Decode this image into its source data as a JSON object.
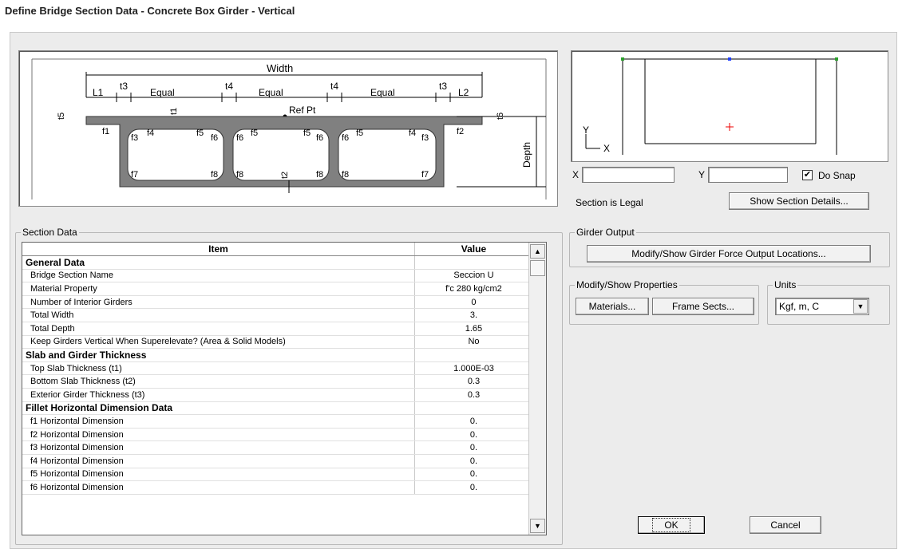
{
  "window": {
    "title": "Define Bridge Section Data - Concrete Box Girder - Vertical"
  },
  "diagram": {
    "width": "Width",
    "L1": "L1",
    "L2": "L2",
    "t3": "t3",
    "t4": "t4",
    "equal": "Equal",
    "ref_pt": "Ref Pt",
    "t1": "t1",
    "t2": "t2",
    "t5": "t5",
    "t6": "t6",
    "depth": "Depth",
    "f1": "f1",
    "f2": "f2",
    "f3": "f3",
    "f4": "f4",
    "f5": "f5",
    "f6": "f6",
    "f7": "f7",
    "f8": "f8"
  },
  "preview": {
    "x_label": "X",
    "y_label": "Y",
    "do_snap_label": "Do Snap",
    "do_snap_checked": true,
    "status": "Section is Legal",
    "show_details_button": "Show Section Details..."
  },
  "section_data": {
    "caption": "Section Data",
    "headers": [
      "Item",
      "Value"
    ],
    "rows": [
      {
        "kind": "hdr",
        "item": "General Data",
        "value": ""
      },
      {
        "kind": "row",
        "item": "Bridge Section Name",
        "value": "Seccion U"
      },
      {
        "kind": "row",
        "item": "Material Property",
        "value": "f'c 280 kg/cm2"
      },
      {
        "kind": "row",
        "item": "Number of Interior Girders",
        "value": "0"
      },
      {
        "kind": "row",
        "item": "Total Width",
        "value": "3."
      },
      {
        "kind": "row",
        "item": "Total Depth",
        "value": "1.65"
      },
      {
        "kind": "row",
        "item": "Keep Girders Vertical When Superelevate?  (Area & Solid Models)",
        "value": "No"
      },
      {
        "kind": "hdr",
        "item": "Slab and Girder Thickness",
        "value": ""
      },
      {
        "kind": "row",
        "item": "Top Slab Thickness (t1)",
        "value": "1.000E-03"
      },
      {
        "kind": "row",
        "item": "Bottom Slab Thickness (t2)",
        "value": "0.3"
      },
      {
        "kind": "row",
        "item": "Exterior Girder Thickness (t3)",
        "value": "0.3"
      },
      {
        "kind": "hdr",
        "item": "Fillet Horizontal Dimension Data",
        "value": ""
      },
      {
        "kind": "row",
        "item": "f1 Horizontal Dimension",
        "value": "0."
      },
      {
        "kind": "row",
        "item": "f2 Horizontal Dimension",
        "value": "0."
      },
      {
        "kind": "row",
        "item": "f3 Horizontal Dimension",
        "value": "0."
      },
      {
        "kind": "row",
        "item": "f4 Horizontal Dimension",
        "value": "0."
      },
      {
        "kind": "row",
        "item": "f5 Horizontal Dimension",
        "value": "0."
      },
      {
        "kind": "row",
        "item": "f6 Horizontal Dimension",
        "value": "0."
      }
    ]
  },
  "girder_output": {
    "caption": "Girder Output",
    "button": "Modify/Show Girder Force Output Locations..."
  },
  "properties": {
    "caption": "Modify/Show Properties",
    "materials_button": "Materials...",
    "frame_sects_button": "Frame Sects..."
  },
  "units": {
    "caption": "Units",
    "selected": "Kgf, m, C"
  },
  "buttons": {
    "ok": "OK",
    "cancel": "Cancel"
  }
}
